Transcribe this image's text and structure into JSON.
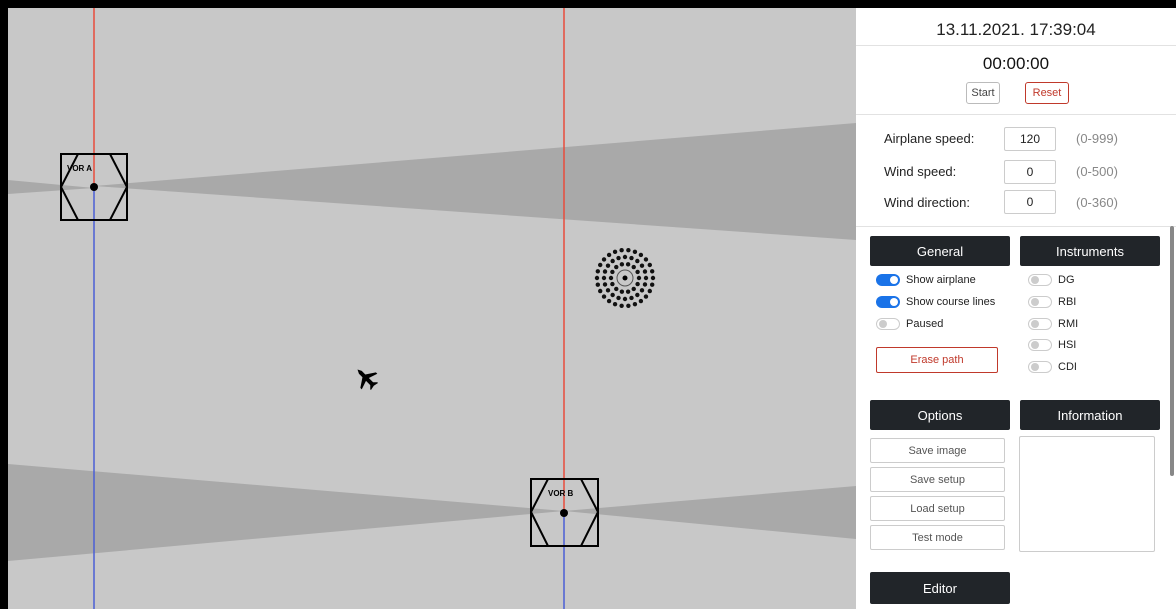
{
  "map": {
    "vors": [
      {
        "label": "VOR A"
      },
      {
        "label": "VOR B"
      }
    ]
  },
  "panel": {
    "datetime": "13.11.2021. 17:39:04",
    "timer": "00:00:00",
    "start_label": "Start",
    "reset_label": "Reset",
    "fields": {
      "airplane_speed": {
        "label": "Airplane speed:",
        "value": "120",
        "range": "(0-999)"
      },
      "wind_speed": {
        "label": "Wind speed:",
        "value": "0",
        "range": "(0-500)"
      },
      "wind_direction": {
        "label": "Wind direction:",
        "value": "0",
        "range": "(0-360)"
      }
    },
    "general": {
      "title": "General",
      "toggles": [
        {
          "label": "Show airplane",
          "on": true
        },
        {
          "label": "Show course lines",
          "on": true
        },
        {
          "label": "Paused",
          "on": false
        }
      ],
      "erase_label": "Erase path"
    },
    "instruments": {
      "title": "Instruments",
      "toggles": [
        {
          "label": "DG",
          "on": false
        },
        {
          "label": "RBI",
          "on": false
        },
        {
          "label": "RMI",
          "on": false
        },
        {
          "label": "HSI",
          "on": false
        },
        {
          "label": "CDI",
          "on": false
        }
      ]
    },
    "options": {
      "title": "Options",
      "buttons": [
        "Save image",
        "Save setup",
        "Load setup",
        "Test mode"
      ]
    },
    "information": {
      "title": "Information"
    },
    "editor": {
      "title": "Editor"
    }
  },
  "colors": {
    "map_bg": "#c8c8c8",
    "sector": "#a9a9a9",
    "course_red": "#e74c3c",
    "course_blue": "#4a5fd6",
    "toggle_on": "#1a73e8",
    "header_dark": "#212529",
    "danger": "#c0392b"
  }
}
